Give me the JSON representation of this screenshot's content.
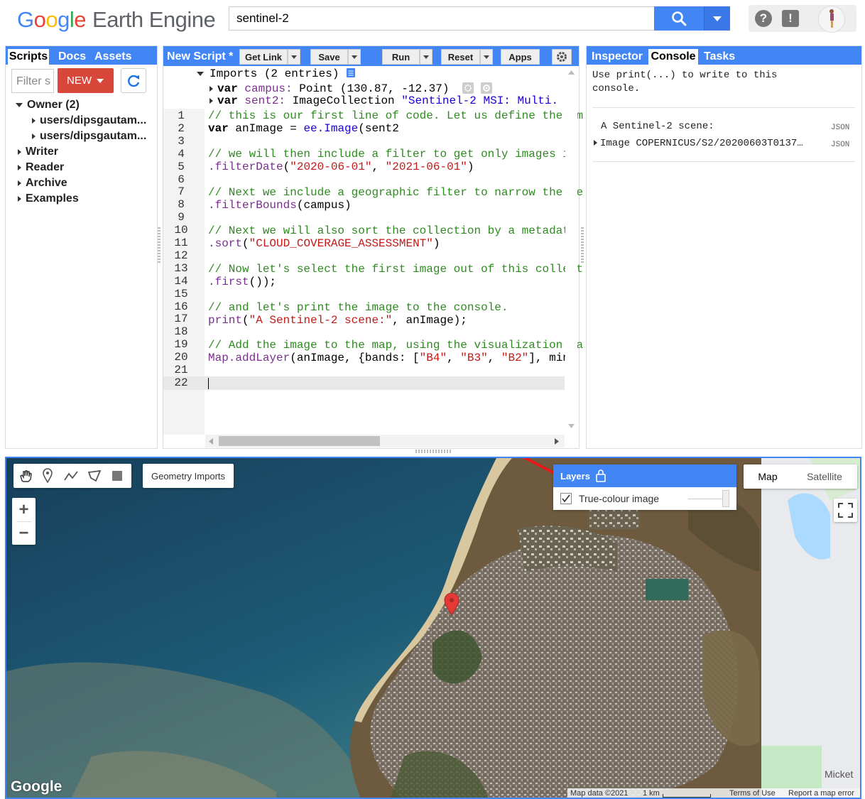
{
  "header": {
    "logo_letters": [
      "G",
      "o",
      "o",
      "g",
      "l",
      "e"
    ],
    "logo_rest": "Earth Engine",
    "search_value": "sentinel-2",
    "icons": [
      "search-icon",
      "dropdown-icon",
      "help-icon",
      "feedback-icon",
      "avatar"
    ]
  },
  "left_panel": {
    "tabs": [
      "Scripts",
      "Docs",
      "Assets"
    ],
    "filter_placeholder": "Filter s",
    "new_label": "NEW",
    "tree": [
      {
        "label": "Owner (2)",
        "expanded": true
      },
      {
        "label": "users/dipsgautam...",
        "child": true
      },
      {
        "label": "users/dipsgautam...",
        "child": true
      },
      {
        "label": "Writer"
      },
      {
        "label": "Reader"
      },
      {
        "label": "Archive"
      },
      {
        "label": "Examples"
      }
    ]
  },
  "editor": {
    "title": "New Script *",
    "buttons": [
      "Get Link",
      "Save",
      "Run",
      "Reset",
      "Apps"
    ],
    "imports_header": "Imports (2 entries)",
    "imports": [
      {
        "kw": "var",
        "name": "campus:",
        "rest": " Point (130.87, -12.37)"
      },
      {
        "kw": "var",
        "name": "sent2:",
        "rest": " ImageCollection ",
        "str": "\"Sentinel-2 MSI: Multi."
      }
    ],
    "line_numbers": [
      "1",
      "2",
      "3",
      "4",
      "5",
      "6",
      "7",
      "8",
      "9",
      "10",
      "11",
      "12",
      "13",
      "14",
      "15",
      "16",
      "17",
      "18",
      "19",
      "20",
      "21",
      "22"
    ],
    "lines": {
      "l1": "// this is our first line of code. Let us define the im",
      "l2a": "var",
      "l2b": " anImage = ",
      "l2c": "ee.Image",
      "l2d": "(sent2",
      "l4": "// we will then include a filter to get only images in",
      "l5a": ".filterDate",
      "l5b": "(",
      "l5c": "\"2020-06-01\"",
      "l5d": ", ",
      "l5e": "\"2021-06-01\"",
      "l5f": ")",
      "l7": "// Next we include a geographic filter to narrow the se",
      "l8a": ".filterBounds",
      "l8b": "(",
      "l8c": "campus",
      "l8d": ")",
      "l10": "// Next we will also sort the collection by a metadata",
      "l11a": ".sort",
      "l11b": "(",
      "l11c": "\"CLOUD_COVERAGE_ASSESSMENT\"",
      "l11d": ")",
      "l13": "// Now let's select the first image out of this collect",
      "l14a": ".first",
      "l14b": "());",
      "l16": "// and let's print the image to the console.",
      "l17a": "print",
      "l17b": "(",
      "l17c": "\"A Sentinel-2 scene:\"",
      "l17d": ", anImage);",
      "l19": "// Add the image to the map, using the visualization pa",
      "l20a": "Map.addLayer",
      "l20b": "(anImage, {bands: [",
      "l20c": "\"B4\"",
      "l20d": ", ",
      "l20e": "\"B3\"",
      "l20f": ", ",
      "l20g": "\"B2\"",
      "l20h": "], min:"
    }
  },
  "right_panel": {
    "tabs": [
      "Inspector",
      "Console",
      "Tasks"
    ],
    "hint": "Use print(...) to write to this\nconsole.",
    "entry_label": "A Sentinel-2 scene:",
    "entry_value": "Image COPERNICUS/S2/20200603T0137…",
    "json_label": "JSON"
  },
  "map": {
    "geometry_imports": "Geometry Imports",
    "zoom_in": "+",
    "zoom_out": "−",
    "layers_title": "Layers",
    "layer_name": "True-colour image",
    "layer_checked": true,
    "map_type": [
      "Map",
      "Satellite"
    ],
    "place_label": "Micket",
    "google": "Google",
    "footer": [
      "Map data ©2021",
      "1 km",
      "Terms of Use",
      "Report a map error"
    ],
    "colors": {
      "water": "#1d4e6b",
      "land": "#6d5a3f",
      "accent": "#4285f4",
      "marker": "#e53935",
      "arrow": "#e51b1b"
    }
  }
}
